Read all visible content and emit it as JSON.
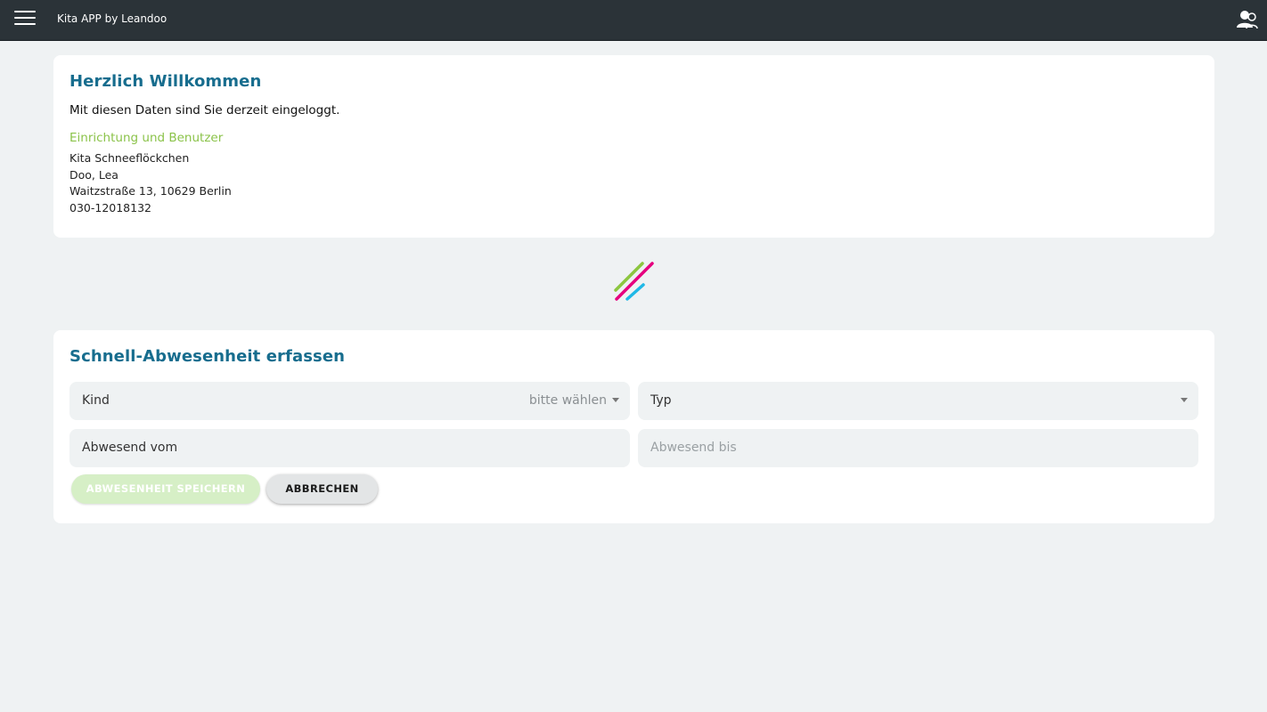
{
  "header": {
    "app_title": "Kita APP by Leandoo",
    "menu_icon": "hamburger-menu-icon",
    "user_icon": "user-switch-icon"
  },
  "welcome": {
    "title": "Herzlich Willkommen",
    "intro": "Mit diesen Daten sind Sie derzeit eingeloggt.",
    "section_label": "Einrichtung und Benutzer",
    "facility": "Kita Schneeflöckchen",
    "user": "Doo, Lea",
    "address": "Waitzstraße 13, 10629 Berlin",
    "phone": "030-12018132"
  },
  "logo": {
    "icon": "leandoo-logo-icon",
    "colors": [
      "#8cc63f",
      "#e5007e",
      "#1fb8e6"
    ]
  },
  "absence": {
    "title": "Schnell-Abwesenheit erfassen",
    "kind_label": "Kind",
    "kind_value": "bitte wählen",
    "typ_label": "Typ",
    "from_label": "Abwesend vom",
    "to_placeholder": "Abwesend bis",
    "save_label": "ABWESENHEIT SPEICHERN",
    "cancel_label": "ABBRECHEN"
  },
  "colors": {
    "topbar": "#2b3338",
    "title_blue": "#176d8e",
    "accent_green": "#8bc34a",
    "background": "#eff2f3"
  }
}
